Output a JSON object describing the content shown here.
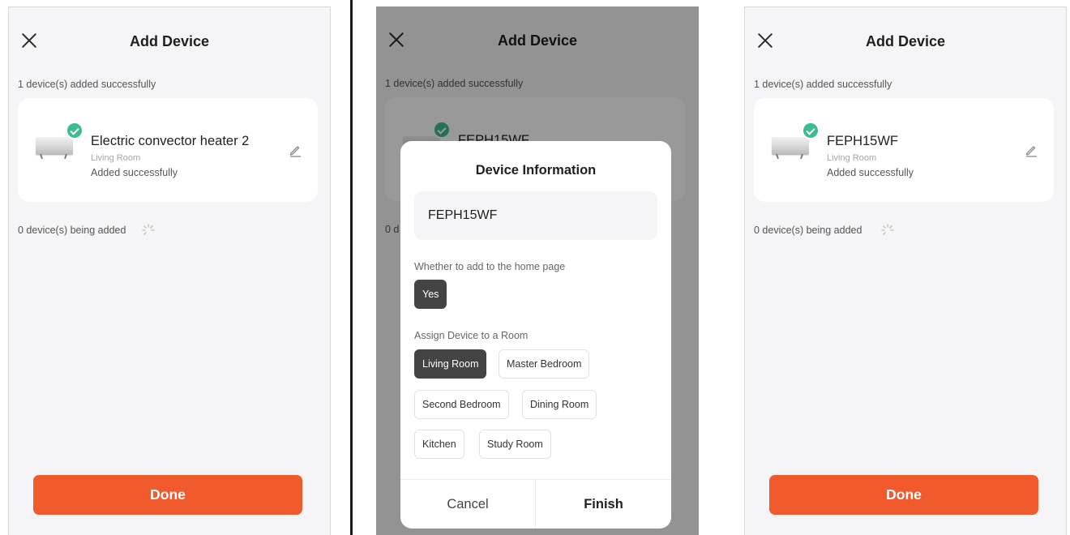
{
  "screens": [
    {
      "title": "Add Device",
      "added_label": "1 device(s) added successfully",
      "device": {
        "name": "Electric convector heater 2",
        "room": "Living Room",
        "status": "Added successfully"
      },
      "adding_label": "0 device(s) being added",
      "done_label": "Done"
    },
    {
      "title": "Add Device",
      "added_label": "1 device(s) added successfully",
      "device": {
        "name": "FEPH15WF"
      },
      "adding_label": "0 d",
      "modal": {
        "title": "Device Information",
        "name_value": "FEPH15WF",
        "home_page_label": "Whether to add to the home page",
        "home_page_option": "Yes",
        "room_label": "Assign Device to a Room",
        "rooms": [
          "Living Room",
          "Master Bedroom",
          "Second Bedroom",
          "Dining Room",
          "Kitchen",
          "Study Room"
        ],
        "selected_room": "Living Room",
        "cancel_label": "Cancel",
        "finish_label": "Finish"
      }
    },
    {
      "title": "Add Device",
      "added_label": "1 device(s) added successfully",
      "device": {
        "name": "FEPH15WF",
        "room": "Living Room",
        "status": "Added successfully"
      },
      "adding_label": "0 device(s) being added",
      "done_label": "Done"
    }
  ],
  "colors": {
    "accent": "#f05a2d",
    "success": "#3dbd8f",
    "selected_chip": "#444444",
    "background": "#f5f5f7"
  },
  "icons": [
    "close-icon",
    "check-icon",
    "edit-icon",
    "spinner-icon",
    "heater-icon"
  ]
}
